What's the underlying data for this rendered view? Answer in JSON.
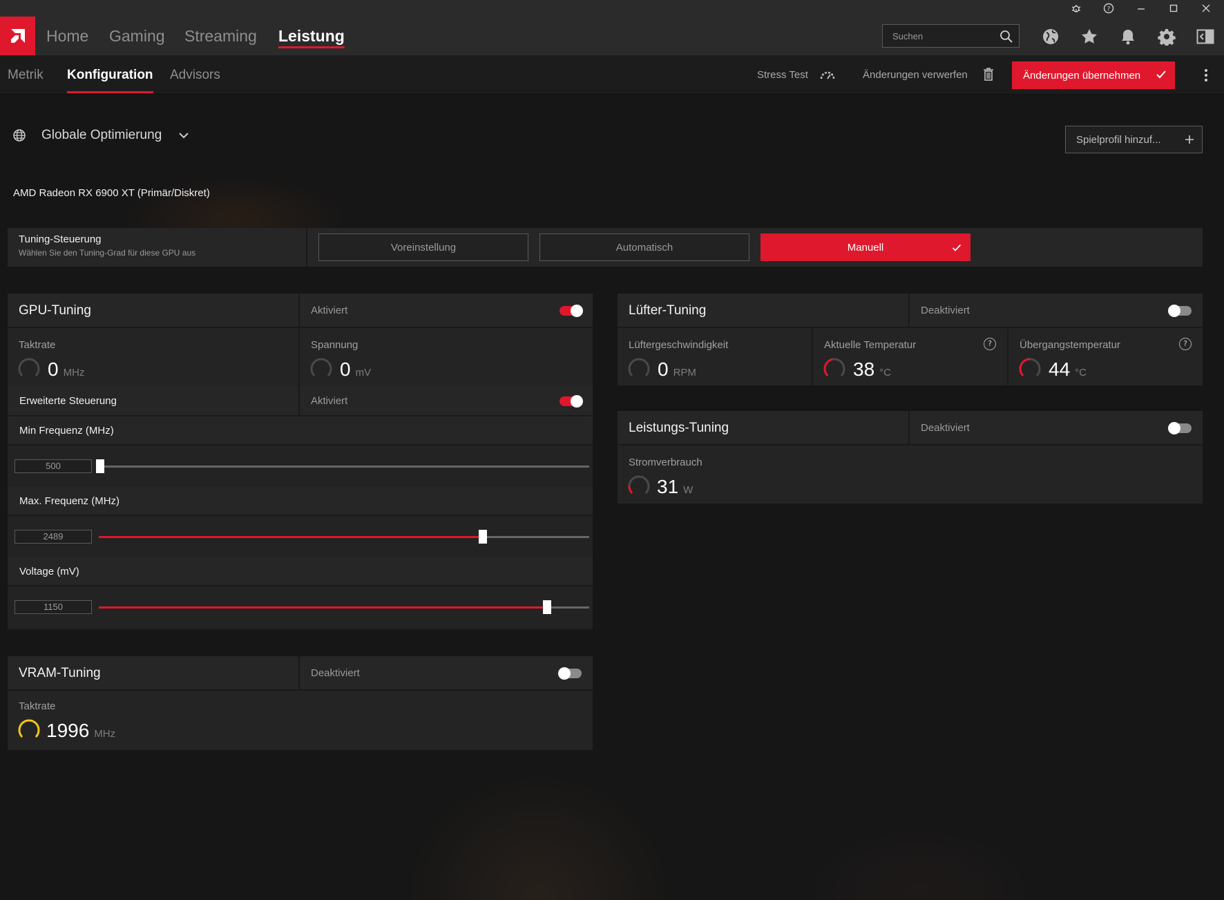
{
  "window": {
    "controls": [
      "bug-icon",
      "help-icon",
      "minimize-icon",
      "maximize-icon",
      "close-icon"
    ]
  },
  "nav": {
    "tabs": [
      "Home",
      "Gaming",
      "Streaming",
      "Leistung"
    ],
    "active_tab": "Leistung",
    "search_placeholder": "Suchen",
    "icons": [
      "globe-icon",
      "star-icon",
      "bell-icon",
      "gear-icon",
      "sidebar-icon"
    ]
  },
  "subnav": {
    "tabs": [
      "Metrik",
      "Konfiguration",
      "Advisors"
    ],
    "active_tab": "Konfiguration",
    "stress_test": "Stress Test",
    "discard": "Änderungen verwerfen",
    "apply": "Änderungen übernehmen"
  },
  "profile": {
    "selected": "Globale Optimierung",
    "add_profile": "Spielprofil hinzuf..."
  },
  "gpu_name": "AMD Radeon RX 6900 XT (Primär/Diskret)",
  "tuning_control": {
    "title": "Tuning-Steuerung",
    "subtitle": "Wählen Sie den Tuning-Grad für diese GPU aus",
    "options": [
      "Voreinstellung",
      "Automatisch",
      "Manuell"
    ],
    "selected": "Manuell"
  },
  "gpu_tuning": {
    "title": "GPU-Tuning",
    "status": "Aktiviert",
    "enabled": true,
    "clock_label": "Taktrate",
    "clock_value": "0",
    "clock_unit": "MHz",
    "voltage_label": "Spannung",
    "voltage_value": "0",
    "voltage_unit": "mV",
    "advanced_label": "Erweiterte Steuerung",
    "advanced_status": "Aktiviert",
    "advanced_enabled": true,
    "min_freq_label": "Min Frequenz (MHz)",
    "min_freq_value": "500",
    "min_freq_level": 0.0,
    "max_freq_label": "Max. Frequenz (MHz)",
    "max_freq_value": "2489",
    "max_freq_level": 0.79,
    "voltage_slider_label": "Voltage (mV)",
    "voltage_slider_value": "1150",
    "voltage_slider_level": 0.92
  },
  "vram_tuning": {
    "title": "VRAM-Tuning",
    "status": "Deaktiviert",
    "enabled": false,
    "clock_label": "Taktrate",
    "clock_value": "1996",
    "clock_unit": "MHz"
  },
  "fan_tuning": {
    "title": "Lüfter-Tuning",
    "status": "Deaktiviert",
    "enabled": false,
    "speed_label": "Lüftergeschwindigkeit",
    "speed_value": "0",
    "speed_unit": "RPM",
    "temp_label": "Aktuelle Temperatur",
    "temp_value": "38",
    "temp_unit": "°C",
    "junction_label": "Übergangstemperatur",
    "junction_value": "44",
    "junction_unit": "°C"
  },
  "power_tuning": {
    "title": "Leistungs-Tuning",
    "status": "Deaktiviert",
    "enabled": false,
    "power_label": "Stromverbrauch",
    "power_value": "31",
    "power_unit": "W"
  },
  "colors": {
    "accent": "#e0182d",
    "gauge_yellow": "#f5c518",
    "background": "#151515",
    "panel": "#232323"
  }
}
